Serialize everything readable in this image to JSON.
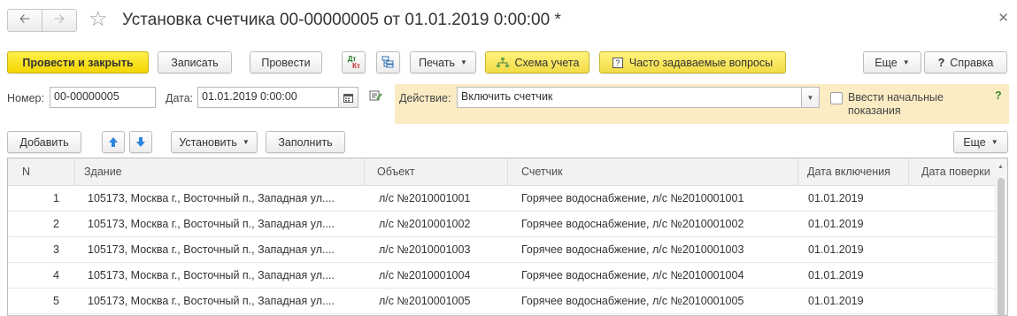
{
  "window": {
    "title": "Установка счетчика 00-00000005 от 01.01.2019 0:00:00 *",
    "back_icon": "arrow-left",
    "forward_icon": "arrow-right",
    "favorite_icon": "star",
    "close_icon": "close"
  },
  "toolbar": {
    "post_close": "Провести и закрыть",
    "save": "Записать",
    "post": "Провести",
    "dt_kt_top": "Дт",
    "dt_kt_bottom": "Кт",
    "print": "Печать",
    "scheme": "Схема учета",
    "faq_icon": "?",
    "faq": "Часто задаваемые вопросы",
    "more": "Еще",
    "help_icon": "?",
    "help": "Справка"
  },
  "form": {
    "number_label": "Номер:",
    "number_value": "00-00000005",
    "date_label": "Дата:",
    "date_value": "01.01.2019  0:00:00",
    "action_label": "Действие:",
    "action_value": "Включить счетчик",
    "initial_readings_label": "Ввести начальные показания",
    "initial_readings_checked": false,
    "help_mark": "?"
  },
  "table_toolbar": {
    "add": "Добавить",
    "install": "Установить",
    "fill": "Заполнить",
    "more": "Еще"
  },
  "table": {
    "columns": [
      "N",
      "Здание",
      "Объект",
      "Счетчик",
      "Дата включения",
      "Дата поверки"
    ],
    "rows": [
      {
        "n": "1",
        "building": "105173, Москва г., Восточный п., Западная ул....",
        "object": "л/с №2010001001",
        "meter": "Горячее водоснабжение, л/с №2010001001",
        "date_on": "01.01.2019",
        "date_check": ""
      },
      {
        "n": "2",
        "building": "105173, Москва г., Восточный п., Западная ул....",
        "object": "л/с №2010001002",
        "meter": "Горячее водоснабжение, л/с №2010001002",
        "date_on": "01.01.2019",
        "date_check": ""
      },
      {
        "n": "3",
        "building": "105173, Москва г., Восточный п., Западная ул....",
        "object": "л/с №2010001003",
        "meter": "Горячее водоснабжение, л/с №2010001003",
        "date_on": "01.01.2019",
        "date_check": ""
      },
      {
        "n": "4",
        "building": "105173, Москва г., Восточный п., Западная ул....",
        "object": "л/с №2010001004",
        "meter": "Горячее водоснабжение, л/с №2010001004",
        "date_on": "01.01.2019",
        "date_check": ""
      },
      {
        "n": "5",
        "building": "105173, Москва г., Восточный п., Западная ул....",
        "object": "л/с №2010001005",
        "meter": "Горячее водоснабжение, л/с №2010001005",
        "date_on": "01.01.2019",
        "date_check": ""
      }
    ]
  },
  "colors": {
    "primary_button": "#f5d900",
    "action_panel": "#fbecc4",
    "move_arrows": "#2e86de"
  }
}
